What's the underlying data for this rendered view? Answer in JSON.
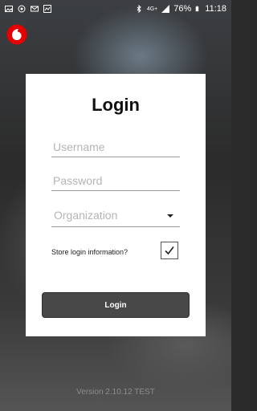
{
  "status_bar": {
    "signal": "4G+",
    "battery": "76%",
    "time": "11:18"
  },
  "icons": {
    "logo": "vodafone-logo",
    "caret": "chevron-down-icon",
    "check": "check-icon"
  },
  "colors": {
    "brand_red": "#e60000",
    "button_bg": "#484848"
  },
  "login": {
    "title": "Login",
    "username_placeholder": "Username",
    "password_placeholder": "Password",
    "organization_placeholder": "Organization",
    "store_label": "Store login information?",
    "store_checked": true,
    "button_label": "Login"
  },
  "footer": {
    "version": "Version 2.10.12 TEST"
  }
}
